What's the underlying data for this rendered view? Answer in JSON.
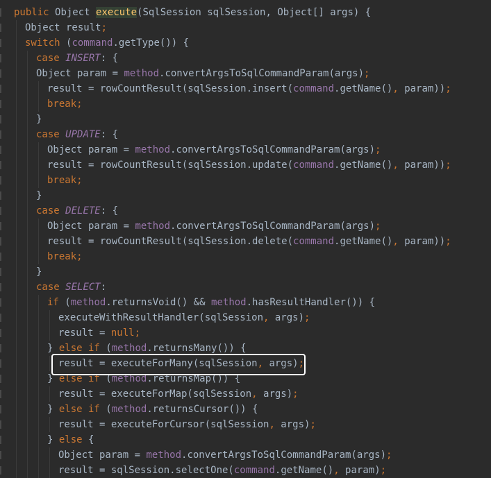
{
  "lines": [
    {
      "indent": 0,
      "segments": [
        {
          "t": "public ",
          "c": "kw"
        },
        {
          "t": "Object ",
          "c": "pl"
        },
        {
          "t": "execute",
          "c": "exec-hl"
        },
        {
          "t": "(SqlSession sqlSession, Object[] args) {",
          "c": "pl"
        }
      ]
    },
    {
      "indent": 1,
      "segments": [
        {
          "t": "Object result",
          "c": "pl"
        },
        {
          "t": ";",
          "c": "kw"
        }
      ]
    },
    {
      "indent": 1,
      "segments": [
        {
          "t": "switch ",
          "c": "kw"
        },
        {
          "t": "(",
          "c": "pl"
        },
        {
          "t": "command",
          "c": "fld"
        },
        {
          "t": ".getType()) {",
          "c": "pl"
        }
      ]
    },
    {
      "indent": 2,
      "segments": [
        {
          "t": "case ",
          "c": "kw"
        },
        {
          "t": "INSERT",
          "c": "const"
        },
        {
          "t": ": {",
          "c": "pl"
        }
      ]
    },
    {
      "indent": 2,
      "segments": [
        {
          "t": "Object param = ",
          "c": "pl"
        },
        {
          "t": "method",
          "c": "fld"
        },
        {
          "t": ".convertArgsToSqlCommandParam(args)",
          "c": "pl"
        },
        {
          "t": ";",
          "c": "kw"
        }
      ]
    },
    {
      "indent": 3,
      "segments": [
        {
          "t": "result = rowCountResult(sqlSession.insert(",
          "c": "pl"
        },
        {
          "t": "command",
          "c": "fld"
        },
        {
          "t": ".getName()",
          "c": "pl"
        },
        {
          "t": ", ",
          "c": "kw"
        },
        {
          "t": "param))",
          "c": "pl"
        },
        {
          "t": ";",
          "c": "kw"
        }
      ]
    },
    {
      "indent": 3,
      "segments": [
        {
          "t": "break;",
          "c": "kw"
        }
      ]
    },
    {
      "indent": 2,
      "segments": [
        {
          "t": "}",
          "c": "pl"
        }
      ]
    },
    {
      "indent": 2,
      "segments": [
        {
          "t": "case ",
          "c": "kw"
        },
        {
          "t": "UPDATE",
          "c": "const"
        },
        {
          "t": ": {",
          "c": "pl"
        }
      ]
    },
    {
      "indent": 3,
      "segments": [
        {
          "t": "Object param = ",
          "c": "pl"
        },
        {
          "t": "method",
          "c": "fld"
        },
        {
          "t": ".convertArgsToSqlCommandParam(args)",
          "c": "pl"
        },
        {
          "t": ";",
          "c": "kw"
        }
      ]
    },
    {
      "indent": 3,
      "segments": [
        {
          "t": "result = rowCountResult(sqlSession.update(",
          "c": "pl"
        },
        {
          "t": "command",
          "c": "fld"
        },
        {
          "t": ".getName()",
          "c": "pl"
        },
        {
          "t": ", ",
          "c": "kw"
        },
        {
          "t": "param))",
          "c": "pl"
        },
        {
          "t": ";",
          "c": "kw"
        }
      ]
    },
    {
      "indent": 3,
      "segments": [
        {
          "t": "break;",
          "c": "kw"
        }
      ]
    },
    {
      "indent": 2,
      "segments": [
        {
          "t": "}",
          "c": "pl"
        }
      ]
    },
    {
      "indent": 2,
      "segments": [
        {
          "t": "case ",
          "c": "kw"
        },
        {
          "t": "DELETE",
          "c": "const"
        },
        {
          "t": ": {",
          "c": "pl"
        }
      ]
    },
    {
      "indent": 3,
      "segments": [
        {
          "t": "Object param = ",
          "c": "pl"
        },
        {
          "t": "method",
          "c": "fld"
        },
        {
          "t": ".convertArgsToSqlCommandParam(args)",
          "c": "pl"
        },
        {
          "t": ";",
          "c": "kw"
        }
      ]
    },
    {
      "indent": 3,
      "segments": [
        {
          "t": "result = rowCountResult(sqlSession.delete(",
          "c": "pl"
        },
        {
          "t": "command",
          "c": "fld"
        },
        {
          "t": ".getName()",
          "c": "pl"
        },
        {
          "t": ", ",
          "c": "kw"
        },
        {
          "t": "param))",
          "c": "pl"
        },
        {
          "t": ";",
          "c": "kw"
        }
      ]
    },
    {
      "indent": 3,
      "segments": [
        {
          "t": "break;",
          "c": "kw"
        }
      ]
    },
    {
      "indent": 2,
      "segments": [
        {
          "t": "}",
          "c": "pl"
        }
      ]
    },
    {
      "indent": 2,
      "segments": [
        {
          "t": "case ",
          "c": "kw"
        },
        {
          "t": "SELECT",
          "c": "const"
        },
        {
          "t": ":",
          "c": "pl"
        }
      ]
    },
    {
      "indent": 3,
      "segments": [
        {
          "t": "if ",
          "c": "kw"
        },
        {
          "t": "(",
          "c": "pl"
        },
        {
          "t": "method",
          "c": "fld"
        },
        {
          "t": ".returnsVoid() && ",
          "c": "pl"
        },
        {
          "t": "method",
          "c": "fld"
        },
        {
          "t": ".hasResultHandler()) {",
          "c": "pl"
        }
      ]
    },
    {
      "indent": 4,
      "segments": [
        {
          "t": "executeWithResultHandler(sqlSession",
          "c": "pl"
        },
        {
          "t": ", ",
          "c": "kw"
        },
        {
          "t": "args)",
          "c": "pl"
        },
        {
          "t": ";",
          "c": "kw"
        }
      ]
    },
    {
      "indent": 4,
      "segments": [
        {
          "t": "result = ",
          "c": "pl"
        },
        {
          "t": "null;",
          "c": "kw"
        }
      ]
    },
    {
      "indent": 3,
      "segments": [
        {
          "t": "} ",
          "c": "pl"
        },
        {
          "t": "else if ",
          "c": "kw"
        },
        {
          "t": "(",
          "c": "pl"
        },
        {
          "t": "method",
          "c": "fld"
        },
        {
          "t": ".returnsMany()) {",
          "c": "pl"
        }
      ]
    },
    {
      "indent": 4,
      "segments": [
        {
          "t": "result = executeForMany(sqlSession",
          "c": "pl"
        },
        {
          "t": ", ",
          "c": "kw"
        },
        {
          "t": "args)",
          "c": "pl"
        },
        {
          "t": ";",
          "c": "kw"
        }
      ]
    },
    {
      "indent": 3,
      "segments": [
        {
          "t": "} ",
          "c": "pl"
        },
        {
          "t": "else if ",
          "c": "kw"
        },
        {
          "t": "(",
          "c": "pl"
        },
        {
          "t": "method",
          "c": "fld"
        },
        {
          "t": ".returnsMap()) {",
          "c": "pl"
        }
      ]
    },
    {
      "indent": 4,
      "segments": [
        {
          "t": "result = executeForMap(sqlSession",
          "c": "pl"
        },
        {
          "t": ", ",
          "c": "kw"
        },
        {
          "t": "args)",
          "c": "pl"
        },
        {
          "t": ";",
          "c": "kw"
        }
      ]
    },
    {
      "indent": 3,
      "segments": [
        {
          "t": "} ",
          "c": "pl"
        },
        {
          "t": "else if ",
          "c": "kw"
        },
        {
          "t": "(",
          "c": "pl"
        },
        {
          "t": "method",
          "c": "fld"
        },
        {
          "t": ".returnsCursor()) {",
          "c": "pl"
        }
      ]
    },
    {
      "indent": 4,
      "segments": [
        {
          "t": "result = executeForCursor(sqlSession",
          "c": "pl"
        },
        {
          "t": ", ",
          "c": "kw"
        },
        {
          "t": "args)",
          "c": "pl"
        },
        {
          "t": ";",
          "c": "kw"
        }
      ]
    },
    {
      "indent": 3,
      "segments": [
        {
          "t": "} ",
          "c": "pl"
        },
        {
          "t": "else ",
          "c": "kw"
        },
        {
          "t": "{",
          "c": "pl"
        }
      ]
    },
    {
      "indent": 4,
      "segments": [
        {
          "t": "Object param = ",
          "c": "pl"
        },
        {
          "t": "method",
          "c": "fld"
        },
        {
          "t": ".convertArgsToSqlCommandParam(args)",
          "c": "pl"
        },
        {
          "t": ";",
          "c": "kw"
        }
      ]
    },
    {
      "indent": 4,
      "segments": [
        {
          "t": "result = sqlSession.selectOne(",
          "c": "pl"
        },
        {
          "t": "command",
          "c": "fld"
        },
        {
          "t": ".getName()",
          "c": "pl"
        },
        {
          "t": ", ",
          "c": "kw"
        },
        {
          "t": "param)",
          "c": "pl"
        },
        {
          "t": ";",
          "c": "kw"
        }
      ]
    }
  ],
  "highlighted_line_index": 23,
  "colors": {
    "background": "#2b2b2b",
    "keyword": "#cc7832",
    "method_name": "#ffc66d",
    "field": "#9876aa",
    "plain": "#a9b7c6",
    "highlight_box": "#ffffff"
  }
}
